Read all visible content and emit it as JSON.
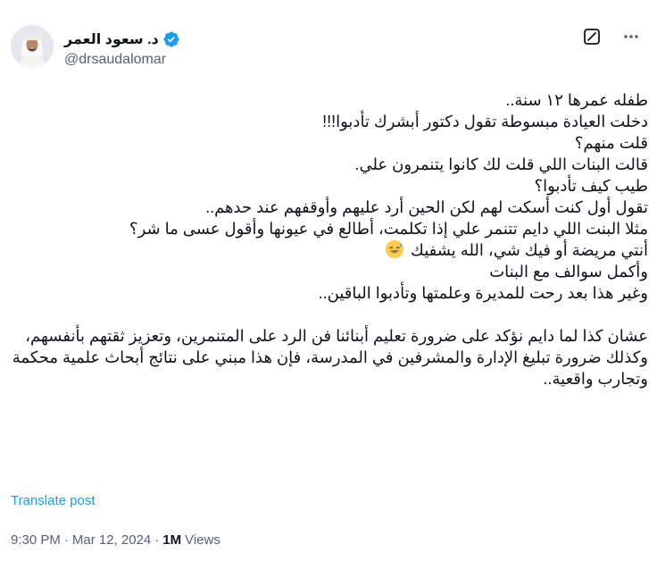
{
  "author": {
    "name": "د. سعود العمر",
    "handle": "@drsaudalomar",
    "verified": true,
    "verified_color": "#1d9bf0"
  },
  "icons": {
    "grok": "grok-icon",
    "more": "more-icon",
    "verified": "verified-badge-icon",
    "emoji": "sweat-smile-emoji"
  },
  "post": {
    "lines": [
      "طفله عمرها ١٢ سنة..",
      "دخلت العيادة مبسوطة تقول دكتور أبشرك تأدبوا!!!",
      "قلت منهم؟",
      "قالت البنات اللي قلت لك كانوا يتنمرون علي.",
      "طيب كيف تأدبوا؟",
      "تقول أول كنت أسكت لهم لكن الحين أرد عليهم وأوقفهم عند حدهم..",
      "مثلا البنت اللي دايم تتنمر علي إذا تكلمت، أطالع في عيونها وأقول عسى ما شر؟",
      "أنتي مريضة أو فيك شي، الله يشفيك",
      "وأكمل سوالف مع البنات",
      "وغير هذا بعد رحت للمديرة وعلمتها وتأدبوا الباقين..",
      "",
      "عشان كذا لما دايم نؤكد على ضرورة تعليم أبنائنا فن الرد على المتنمرين، وتعزيز ثقتهم بأنفسهم،",
      "وكذلك ضرورة تبليغ الإدارة والمشرفين في المدرسة، فإن هذا مبني على نتائج أبحاث علمية محكمة وتجارب واقعية.."
    ]
  },
  "translate_label": "Translate post",
  "meta": {
    "time": "9:30 PM",
    "separator": "·",
    "date": "Mar 12, 2024",
    "views_count": "1M",
    "views_label": "Views"
  }
}
